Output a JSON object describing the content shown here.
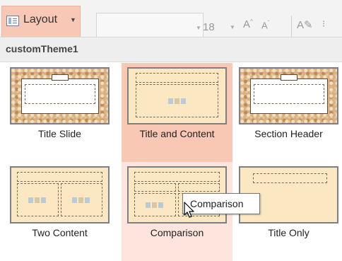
{
  "ribbon": {
    "layout_label": "Layout",
    "font_size_value": "18",
    "icons": [
      "layout-icon",
      "dropdown-arrow-icon",
      "increase-font-icon",
      "decrease-font-icon",
      "clear-format-icon"
    ]
  },
  "gallery": {
    "theme_name": "customTheme1",
    "layouts": [
      {
        "label": "Title Slide"
      },
      {
        "label": "Title and Content"
      },
      {
        "label": "Section Header"
      },
      {
        "label": "Two Content"
      },
      {
        "label": "Comparison"
      },
      {
        "label": "Title Only"
      }
    ]
  },
  "tooltip": {
    "text": "Comparison"
  },
  "colors": {
    "hover_highlight": "#f8c8b4",
    "selected_tint": "#fde5dd",
    "slide_fill": "#fbe8c3",
    "ornate_fill": "#d8b083"
  }
}
